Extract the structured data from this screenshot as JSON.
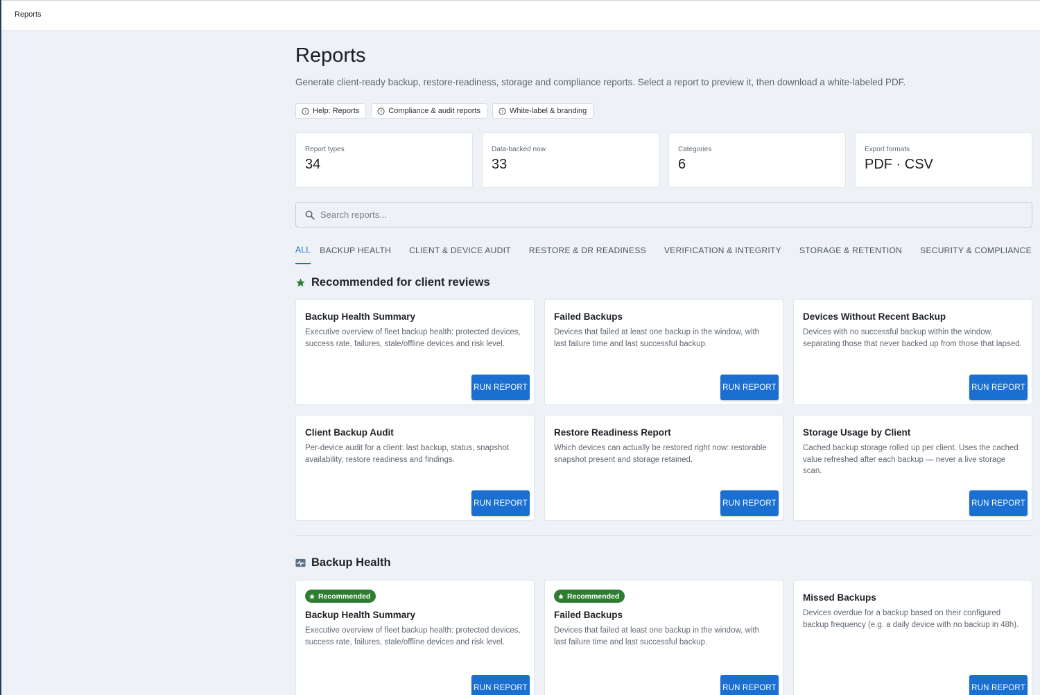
{
  "topbar": {
    "crumb": "Reports"
  },
  "page": {
    "title": "Reports",
    "subtitle": "Generate client-ready backup, restore-readiness, storage and compliance reports. Select a report to preview it, then download a white-labeled PDF."
  },
  "help_links": [
    {
      "label": "Help: Reports"
    },
    {
      "label": "Compliance & audit reports"
    },
    {
      "label": "White-label & branding"
    }
  ],
  "stats": [
    {
      "label": "Report types",
      "value": "34"
    },
    {
      "label": "Data-backed now",
      "value": "33"
    },
    {
      "label": "Categories",
      "value": "6"
    },
    {
      "label": "Export formats",
      "value": "PDF · CSV"
    }
  ],
  "search": {
    "placeholder": "Search reports..."
  },
  "tabs": [
    {
      "label": "ALL",
      "active": true
    },
    {
      "label": "BACKUP HEALTH"
    },
    {
      "label": "CLIENT & DEVICE AUDIT"
    },
    {
      "label": "RESTORE & DR READINESS"
    },
    {
      "label": "VERIFICATION & INTEGRITY"
    },
    {
      "label": "STORAGE & RETENTION"
    },
    {
      "label": "SECURITY & COMPLIANCE"
    }
  ],
  "recommended": {
    "title": "Recommended for client reviews",
    "icon": "star-icon",
    "icon_color": "#2e7d32",
    "cards": [
      {
        "title": "Backup Health Summary",
        "desc": "Executive overview of fleet backup health: protected devices, success rate, failures, stale/offline devices and risk level.",
        "button": "RUN REPORT"
      },
      {
        "title": "Failed Backups",
        "desc": "Devices that failed at least one backup in the window, with last failure time and last successful backup.",
        "button": "RUN REPORT"
      },
      {
        "title": "Devices Without Recent Backup",
        "desc": "Devices with no successful backup within the window, separating those that never backed up from those that lapsed.",
        "button": "RUN REPORT"
      },
      {
        "title": "Client Backup Audit",
        "desc": "Per-device audit for a client: last backup, status, snapshot availability, restore readiness and findings.",
        "button": "RUN REPORT"
      },
      {
        "title": "Restore Readiness Report",
        "desc": "Which devices can actually be restored right now: restorable snapshot present and storage retained.",
        "button": "RUN REPORT"
      },
      {
        "title": "Storage Usage by Client",
        "desc": "Cached backup storage rolled up per client. Uses the cached value refreshed after each backup — never a live storage scan.",
        "button": "RUN REPORT"
      }
    ]
  },
  "backup_health": {
    "title": "Backup Health",
    "icon": "monitor-heartbeat-icon",
    "badge_label": "Recommended",
    "cards": [
      {
        "badge": "Recommended",
        "title": "Backup Health Summary",
        "desc": "Executive overview of fleet backup health: protected devices, success rate, failures, stale/offline devices and risk level.",
        "button": "RUN REPORT"
      },
      {
        "badge": "Recommended",
        "title": "Failed Backups",
        "desc": "Devices that failed at least one backup in the window, with last failure time and last successful backup.",
        "button": "RUN REPORT"
      },
      {
        "title": "Missed Backups",
        "desc": "Devices overdue for a backup based on their configured backup frequency (e.g. a daily device with no backup in 48h).",
        "button": "RUN REPORT"
      }
    ]
  },
  "colors": {
    "accent": "#1a6fd1",
    "recommended_badge": "#2e7d32",
    "background": "#eef2f6"
  }
}
